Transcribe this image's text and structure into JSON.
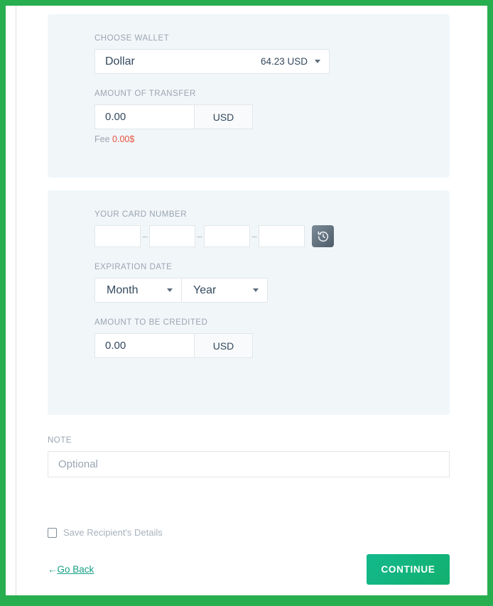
{
  "theme": {
    "frame_color": "#27ae4f",
    "panel_bg": "#f1f6f9",
    "accent_green": "#16a085",
    "fee_red": "#e8523f",
    "label_gray": "#9aa5b1"
  },
  "wallet_section": {
    "label": "CHOOSE WALLET",
    "selected_wallet": "Dollar",
    "balance": "64.23 USD",
    "caret_icon": "chevron-down-icon",
    "transfer_label": "AMOUNT OF TRANSFER",
    "transfer_amount": "0.00",
    "transfer_currency": "USD",
    "fee_prefix": "Fee",
    "fee_value": "0.00$"
  },
  "card_section": {
    "card_label": "YOUR CARD NUMBER",
    "card_segments": [
      "",
      "",
      "",
      ""
    ],
    "card_separator": "–",
    "history_icon": "history-restore-icon",
    "expiry_label": "EXPIRATION DATE",
    "month_placeholder": "Month",
    "year_placeholder": "Year",
    "credited_label": "AMOUNT TO BE CREDITED",
    "credited_amount": "0.00",
    "credited_currency": "USD"
  },
  "note_section": {
    "label": "NOTE",
    "placeholder": "Optional",
    "value": ""
  },
  "footer": {
    "save_checkbox_label": "Save Recipient's Details",
    "save_checked": false,
    "go_back_arrow": "←",
    "go_back_text": "Go Back",
    "continue_label": "CONTINUE"
  }
}
